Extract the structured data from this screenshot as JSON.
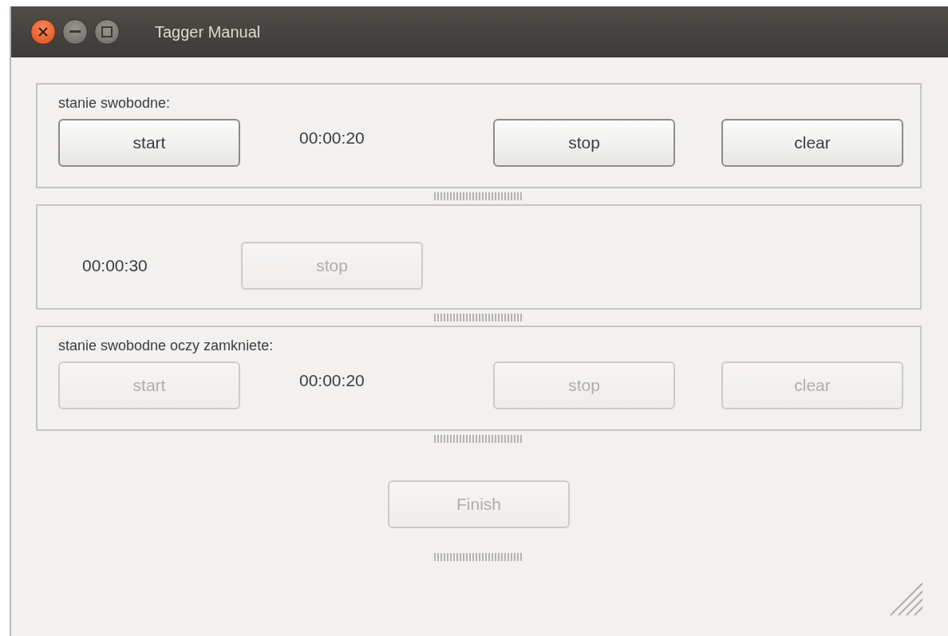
{
  "window": {
    "title": "Tagger Manual"
  },
  "sections": [
    {
      "kind": "full",
      "label": "stanie swobodne:",
      "start": {
        "label": "start",
        "disabled": false
      },
      "time": "00:00:20",
      "stop": {
        "label": "stop",
        "disabled": false
      },
      "clear": {
        "label": "clear",
        "disabled": false
      }
    },
    {
      "kind": "compact",
      "time": "00:00:30",
      "stop": {
        "label": "stop",
        "disabled": true
      }
    },
    {
      "kind": "full",
      "label": "stanie swobodne oczy zamkniete:",
      "start": {
        "label": "start",
        "disabled": true
      },
      "time": "00:00:20",
      "stop": {
        "label": "stop",
        "disabled": true
      },
      "clear": {
        "label": "clear",
        "disabled": true
      }
    }
  ],
  "finish": {
    "label": "Finish",
    "disabled": true
  }
}
